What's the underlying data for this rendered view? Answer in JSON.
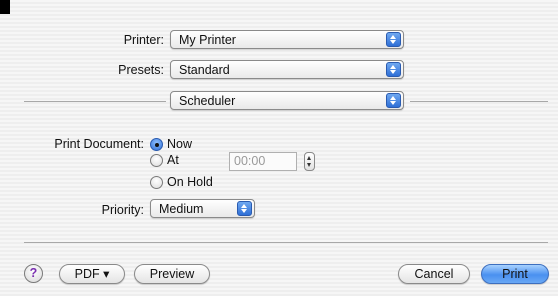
{
  "printer": {
    "label": "Printer:",
    "value": "My Printer"
  },
  "presets": {
    "label": "Presets:",
    "value": "Standard"
  },
  "panel": {
    "value": "Scheduler"
  },
  "print_document": {
    "label": "Print Document:",
    "options": [
      "Now",
      "At",
      "On Hold"
    ],
    "selected": "Now",
    "time": "00:00"
  },
  "priority": {
    "label": "Priority:",
    "value": "Medium"
  },
  "buttons": {
    "help": "?",
    "pdf": "PDF ▾",
    "preview": "Preview",
    "cancel": "Cancel",
    "print": "Print"
  },
  "colors": {
    "accent": "#4a90f0"
  }
}
